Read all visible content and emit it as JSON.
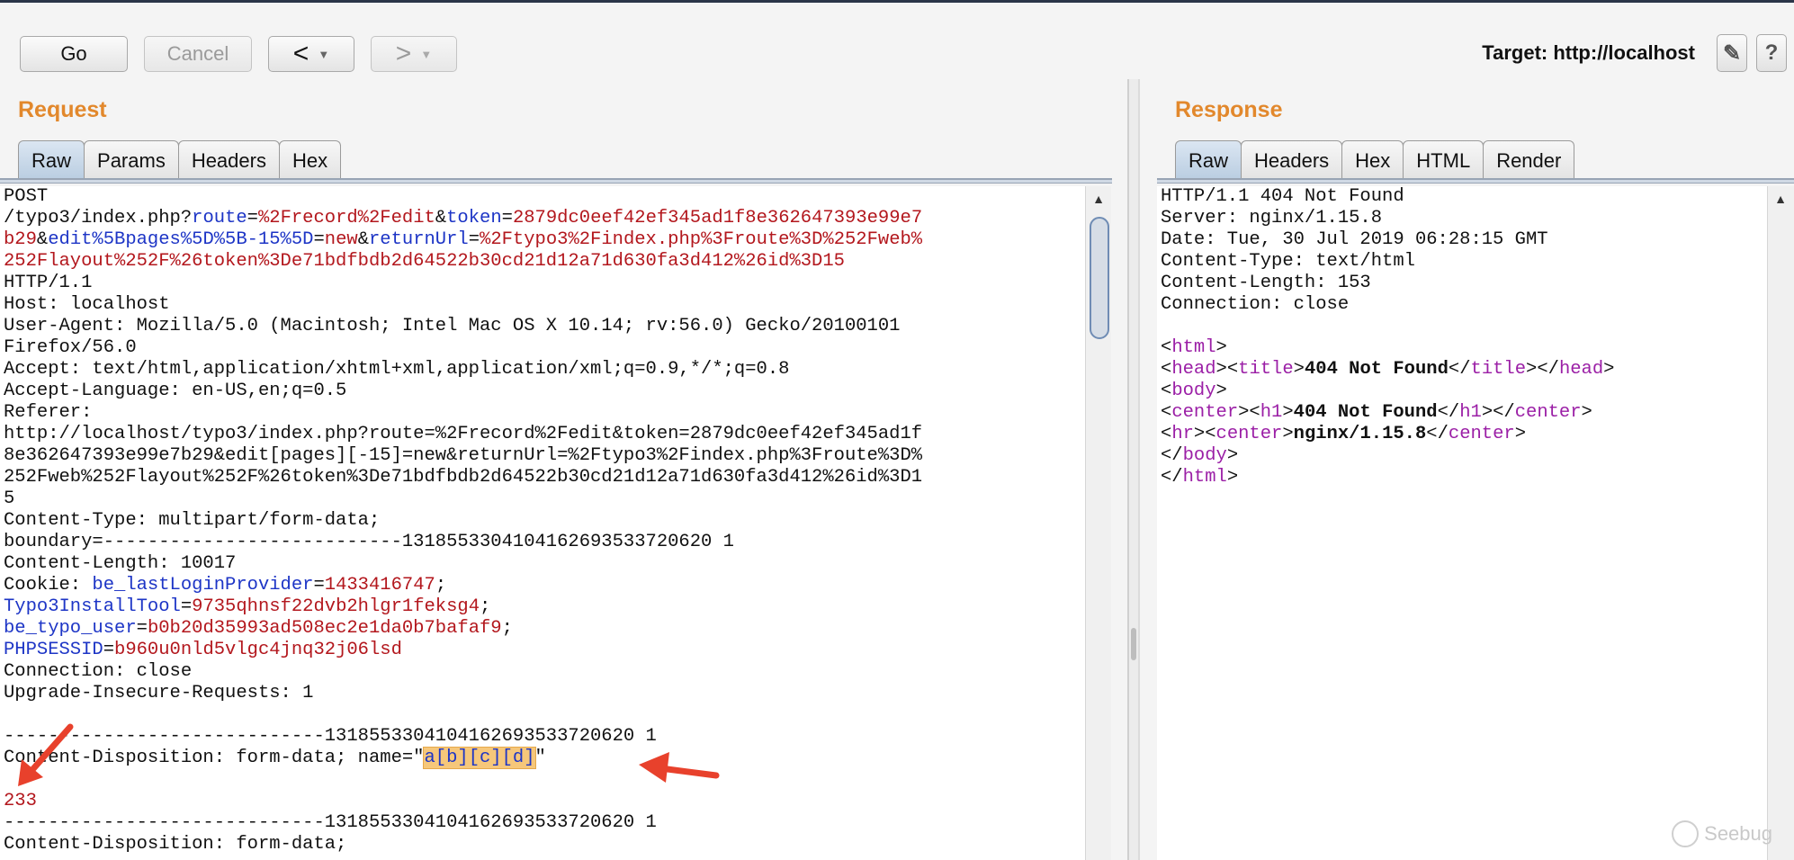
{
  "toolbar": {
    "go": "Go",
    "cancel": "Cancel",
    "back": "<",
    "forward": ">",
    "dropdown": "▼",
    "target_label": "Target: http://localhost",
    "edit_icon": "✎",
    "help_icon": "?"
  },
  "request": {
    "title": "Request",
    "tabs": [
      "Raw",
      "Params",
      "Headers",
      "Hex"
    ],
    "active_tab": "Raw",
    "highlighted_text": "a[b][c][d]"
  },
  "response": {
    "title": "Response",
    "tabs": [
      "Raw",
      "Headers",
      "Hex",
      "HTML",
      "Render"
    ],
    "active_tab": "Raw"
  },
  "raw_text": {
    "request": "POST\n/typo3/index.php?route=%2Frecord%2Fedit&token=2879dc0eef42ef345ad1f8e362647393e99e7\nb29&edit%5Bpages%5D%5B-15%5D=new&returnUrl=%2Ftypo3%2Findex.php%3Froute%3D%252Fweb%\n252Flayout%252F%26token%3De71bdfbdb2d64522b30cd21d12a71d630fa3d412%26id%3D15\nHTTP/1.1\nHost: localhost\nUser-Agent: Mozilla/5.0 (Macintosh; Intel Mac OS X 10.14; rv:56.0) Gecko/20100101\nFirefox/56.0\nAccept: text/html,application/xhtml+xml,application/xml;q=0.9,*/*;q=0.8\nAccept-Language: en-US,en;q=0.5\nReferer:\nhttp://localhost/typo3/index.php?route=%2Frecord%2Fedit&token=2879dc0eef42ef345ad1f\n8e362647393e99e7b29&edit[pages][-15]=new&returnUrl=%2Ftypo3%2Findex.php%3Froute%3D%\n252Fweb%252Flayout%252F%26token%3De71bdfbdb2d64522b30cd21d12a71d630fa3d412%26id%3D1\n5\nContent-Type: multipart/form-data;\nboundary=---------------------------1318553304104162693533720620 1\nContent-Length: 10017\nCookie: be_lastLoginProvider=1433416747;\nTypo3InstallTool=9735qhnsf22dvb2hlgr1feksg4;\nbe_typo_user=b0b20d35993ad508ec2e1da0b7bafaf9;\nPHPSESSID=b960u0nld5vlgc4jnq32j06lsd\nConnection: close\nUpgrade-Insecure-Requests: 1\n\n-----------------------------1318553304104162693533720620 1\nContent-Disposition: form-data; name=\"a[b][c][d]\"\n\n233\n-----------------------------1318553304104162693533720620 1\nContent-Disposition: form-data;",
    "response": "HTTP/1.1 404 Not Found\nServer: nginx/1.15.8\nDate: Tue, 30 Jul 2019 06:28:15 GMT\nContent-Type: text/html\nContent-Length: 153\nConnection: close\n\n<html>\n<head><title>404 Not Found</title></head>\n<body>\n<center><h1>404 Not Found</h1></center>\n<hr><center>nginx/1.15.8</center>\n</body>\n</html>"
  },
  "watermark": "Seebug",
  "colors": {
    "param_name": "#1d35c6",
    "param_value": "#b3171d",
    "html_tag": "#9b1fa6",
    "section_title": "#e2882c",
    "highlight": "#f6c77a",
    "annotation_arrow": "#e8412c"
  }
}
